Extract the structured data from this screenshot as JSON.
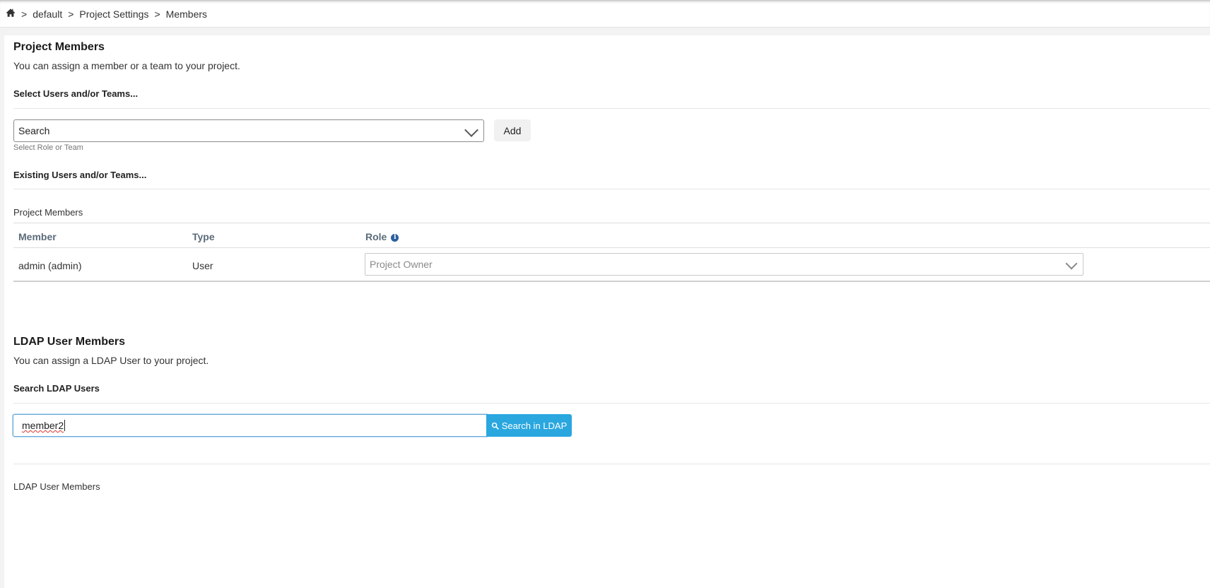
{
  "breadcrumb": {
    "items": [
      "default",
      "Project Settings",
      "Members"
    ],
    "separator": ">"
  },
  "project_members": {
    "title": "Project Members",
    "description": "You can assign a member or a team to your project.",
    "select_label": "Select Users and/or Teams...",
    "search_placeholder": "Search",
    "add_label": "Add",
    "hint": "Select Role or Team",
    "existing_label": "Existing Users and/or Teams...",
    "table_title": "Project Members",
    "columns": [
      "Member",
      "Type",
      "Role"
    ],
    "rows": [
      {
        "member": "admin (admin)",
        "type": "User",
        "role": "Project Owner"
      }
    ]
  },
  "ldap": {
    "title": "LDAP User Members",
    "description": "You can assign a LDAP User to your project.",
    "search_label": "Search LDAP Users",
    "input_value": "member2",
    "search_button": "Search in LDAP",
    "list_title": "LDAP User Members"
  },
  "colors": {
    "accent": "#2aa7df",
    "info_icon": "#2b5f9e"
  }
}
